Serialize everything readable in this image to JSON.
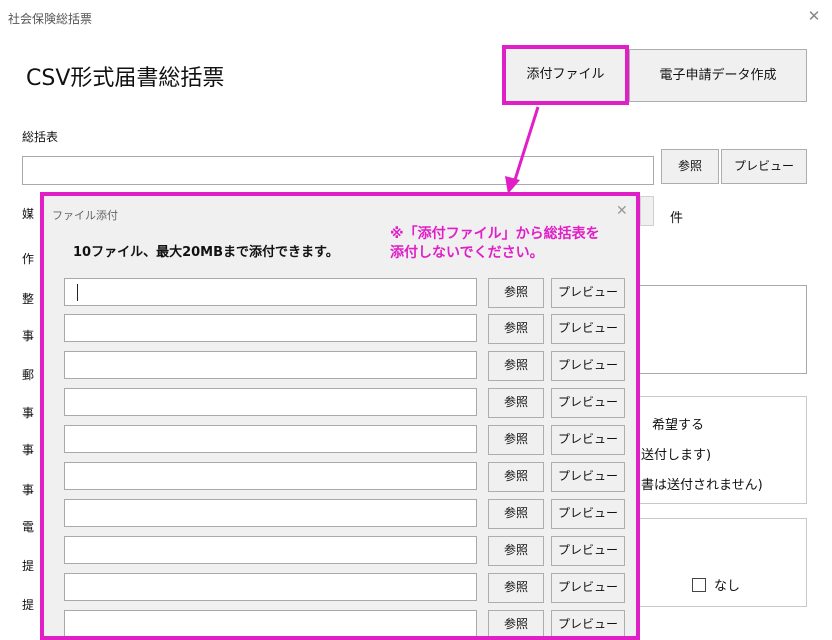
{
  "window": {
    "title": "社会保険総括票"
  },
  "main": {
    "title": "CSV形式届書総括票",
    "toolbar": {
      "attach_label": "添付ファイル",
      "create_label": "電子申請データ作成"
    },
    "summary_label": "総括表",
    "ref_label": "参照",
    "preview_label": "プレビュー",
    "count_unit": "件",
    "partial_labels": [
      "媒",
      "作",
      "整",
      "事",
      "郵",
      "事",
      "事",
      "事",
      "電",
      "提",
      "提"
    ],
    "option_texts": [
      "希望する",
      "送付します)",
      "書は送付されません)"
    ],
    "none_label": "なし"
  },
  "dialog": {
    "title": "ファイル添付",
    "info": "10ファイル、最大20MBまで添付できます。",
    "note_lines": [
      "※「添付ファイル」から総括表を",
      "添付しないでください。"
    ],
    "ref_label": "参照",
    "preview_label": "プレビュー",
    "files": [
      "",
      "",
      "",
      "",
      "",
      "",
      "",
      "",
      "",
      ""
    ]
  },
  "colors": {
    "highlight": "#e01fc7"
  }
}
